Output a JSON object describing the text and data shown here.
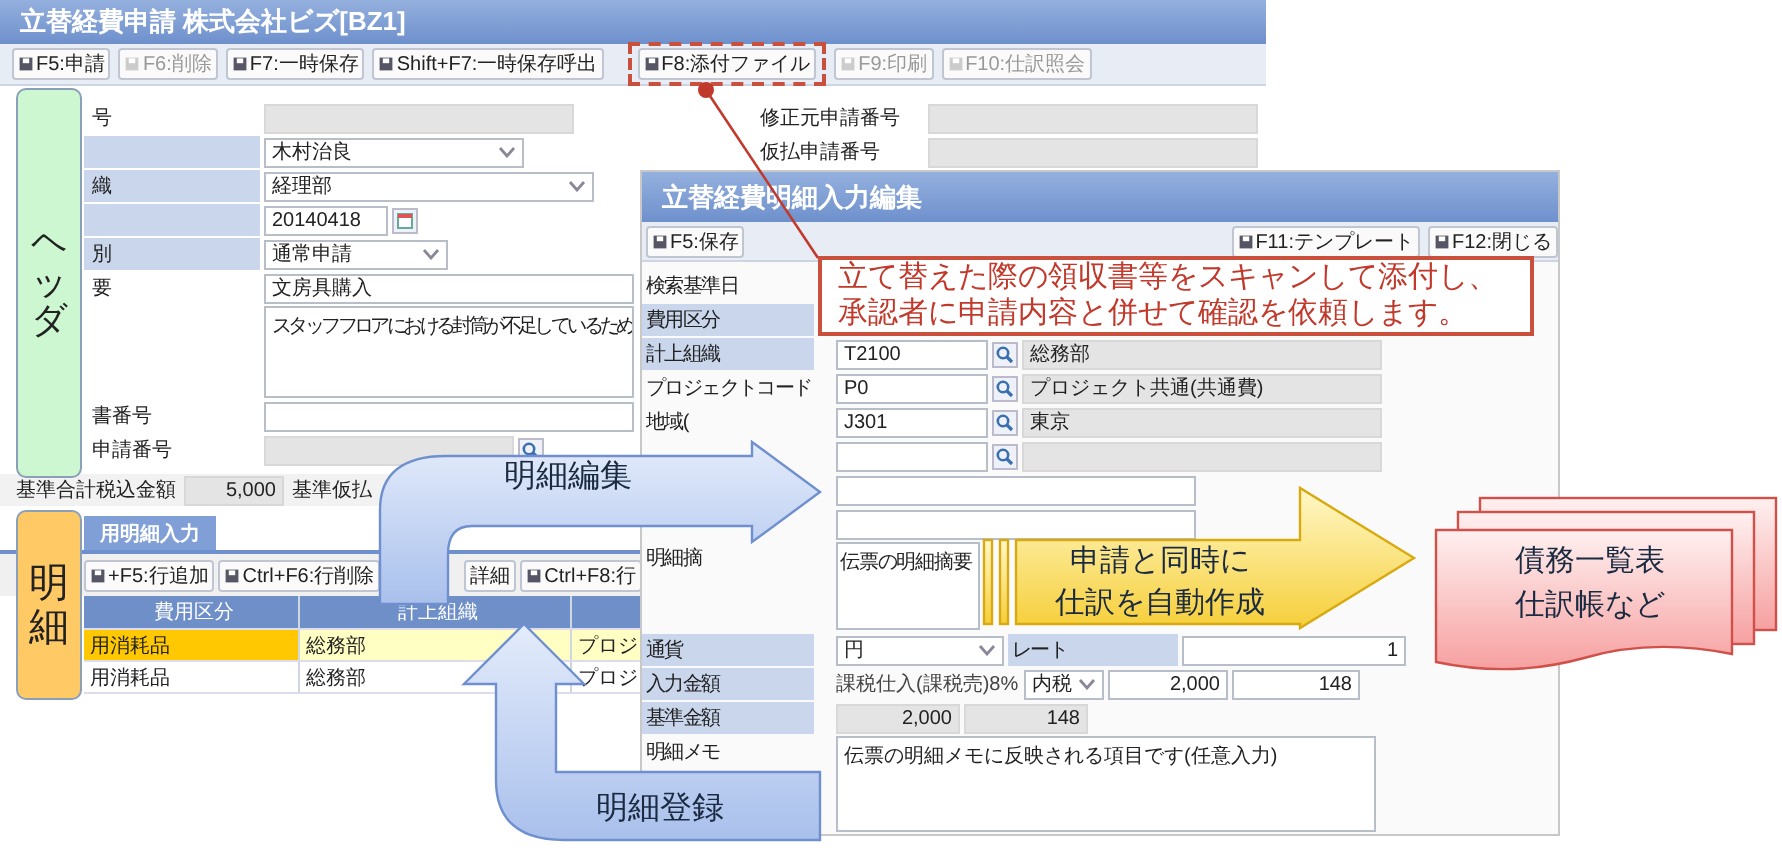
{
  "main_window": {
    "title": "立替経費申請 株式会社ビズ[BZ1]",
    "toolbar": [
      {
        "label": "F5:申請",
        "disabled": false,
        "highlighted": false
      },
      {
        "label": "F6:削除",
        "disabled": true,
        "highlighted": false
      },
      {
        "label": "F7:一時保存",
        "disabled": false,
        "highlighted": false
      },
      {
        "label": "Shift+F7:一時保存呼出",
        "disabled": false,
        "highlighted": false
      },
      {
        "label": "F8:添付ファイル",
        "disabled": false,
        "highlighted": true
      },
      {
        "label": "F9:印刷",
        "disabled": true,
        "highlighted": false
      },
      {
        "label": "F10:仕訳照会",
        "disabled": true,
        "highlighted": false
      }
    ],
    "header_fields": [
      {
        "label": "号",
        "kind": "readonly",
        "shaded": false
      },
      {
        "kind": "select",
        "value": "木村治良",
        "shaded": true
      },
      {
        "label": "織",
        "kind": "select",
        "value": "経理部",
        "shaded": true
      },
      {
        "kind": "date",
        "value": "20140418",
        "shaded": true
      },
      {
        "label": "別",
        "kind": "select",
        "value": "通常申請",
        "shaded": true
      },
      {
        "label": "要",
        "kind": "text",
        "value": "文房具購入",
        "shaded": false
      },
      {
        "kind": "textarea",
        "value": "スタッフフロアにおける封筒が不足しているため",
        "shaded": false
      },
      {
        "label": "書番号",
        "kind": "text",
        "shaded": false
      },
      {
        "label": "申請番号",
        "kind": "lookup",
        "shaded": false
      }
    ],
    "side_fields": [
      {
        "label": "修正元申請番号"
      },
      {
        "label": "仮払申請番号"
      }
    ],
    "total": {
      "label": "基準合計税込金額",
      "value": "5,000",
      "next_label": "基準仮払"
    },
    "detail_tab": "用明細入力",
    "detail_toolbar": [
      {
        "label": "+F5:行追加"
      },
      {
        "label": "Ctrl+F6:行削除"
      },
      {
        "label": "詳細"
      },
      {
        "label": "Ctrl+F8:行"
      }
    ],
    "table": {
      "columns": [
        "費用区分",
        "計上組織"
      ],
      "rows": [
        {
          "selected": true,
          "cells": [
            "用消耗品",
            "総務部",
            "プロジ"
          ]
        },
        {
          "selected": false,
          "cells": [
            "用消耗品",
            "総務部",
            "プロジ"
          ]
        }
      ]
    }
  },
  "dialog": {
    "title": "立替経費明細入力編集",
    "toolbar": [
      "F5:保存",
      "F11:テンプレート",
      "F12:閉じる"
    ],
    "fields": [
      {
        "label": "検索基準日",
        "kind": "blank",
        "shaded": false
      },
      {
        "label": "費用区分",
        "kind": "blank",
        "shaded": true
      },
      {
        "label": "計上組織",
        "kind": "lookup",
        "code": "T2100",
        "name": "総務部",
        "shaded": true
      },
      {
        "label": "プロジェクトコード",
        "kind": "lookup",
        "code": "P0",
        "name": "プロジェクト共通(共通費)",
        "shaded": false
      },
      {
        "label": "地域(",
        "kind": "lookup",
        "code": "J301",
        "name": "東京",
        "shaded": false
      },
      {
        "kind": "lookup",
        "shaded": false
      },
      {
        "kind": "text",
        "shaded": false
      },
      {
        "kind": "text",
        "shaded": false
      },
      {
        "label": "明細摘",
        "kind": "textarea",
        "value": "伝票の明細摘要",
        "shaded": false
      },
      {
        "label": "通貨",
        "kind": "currency",
        "value": "円",
        "rate_label": "レート",
        "rate": "1",
        "shaded": true
      },
      {
        "label": "入力金額",
        "kind": "amount",
        "tax": "課税仕入(課税売)8%",
        "mode": "内税",
        "amount": "2,000",
        "tax_amount": "148",
        "shaded": true
      },
      {
        "label": "基準金額",
        "kind": "base",
        "amount": "2,000",
        "tax_amount": "148",
        "shaded": true
      },
      {
        "label": "明細メモ",
        "kind": "memo",
        "value": "伝票の明細メモに反映される項目です(任意入力)",
        "shaded": false
      }
    ]
  },
  "annotations": {
    "attach_note": [
      "立て替えた際の領収書等をスキャンして添付し、",
      "承認者に申請内容と併せて確認を依頼します。"
    ],
    "header_tag": "ヘッダ",
    "detail_tag": "明細",
    "edit_arrow": "明細編集",
    "register_arrow": "明細登録",
    "journal_arrow": [
      "申請と同時に",
      "仕訳を自動作成"
    ],
    "reports": [
      "債務一覧表",
      "仕訳帳など"
    ]
  }
}
